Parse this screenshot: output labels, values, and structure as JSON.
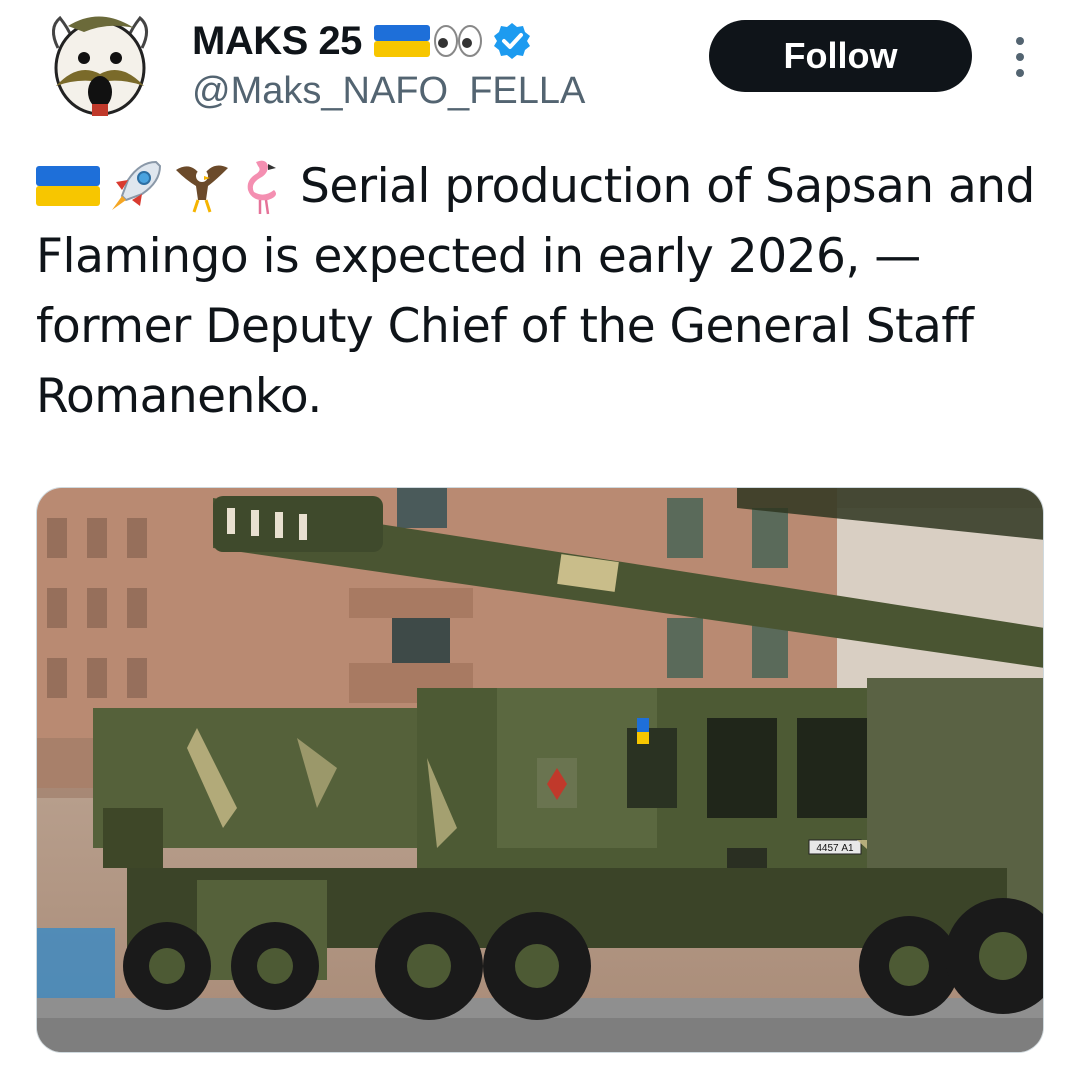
{
  "author": {
    "display_name": "MAKS 25",
    "name_emoji": [
      "ukraine-flag",
      "eyes"
    ],
    "verified": true,
    "handle": "@Maks_NAFO_FELLA"
  },
  "actions": {
    "follow_label": "Follow",
    "more_icon": "more-vertical-icon"
  },
  "tweet": {
    "emoji_prefix": [
      "ukraine-flag",
      "rocket",
      "eagle",
      "flamingo"
    ],
    "text": "Serial production of Sapsan and Flamingo is expected in early 2026, — former Deputy Chief of the General Staff Romanenko."
  },
  "media": {
    "kind": "photo",
    "plate_text": "4457 А1"
  },
  "colors": {
    "text": "#0f1419",
    "secondary": "#536471",
    "verified_blue": "#1d9bf0",
    "button_bg": "#0f1419"
  }
}
